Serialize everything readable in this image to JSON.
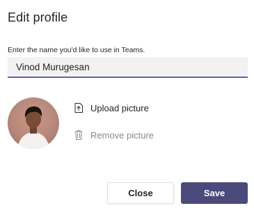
{
  "dialog": {
    "title": "Edit profile",
    "name_label": "Enter the name you'd like to use in Teams.",
    "name_value": "Vinod Murugesan"
  },
  "picture": {
    "upload_label": "Upload picture",
    "upload_icon": "upload-icon",
    "remove_label": "Remove picture",
    "remove_icon": "trash-icon"
  },
  "buttons": {
    "close_label": "Close",
    "save_label": "Save"
  },
  "colors": {
    "accent": "#5b5fc7",
    "save_button": "#4b4a7a",
    "input_background": "#f3f2f1",
    "disabled_text": "#8a8886"
  }
}
